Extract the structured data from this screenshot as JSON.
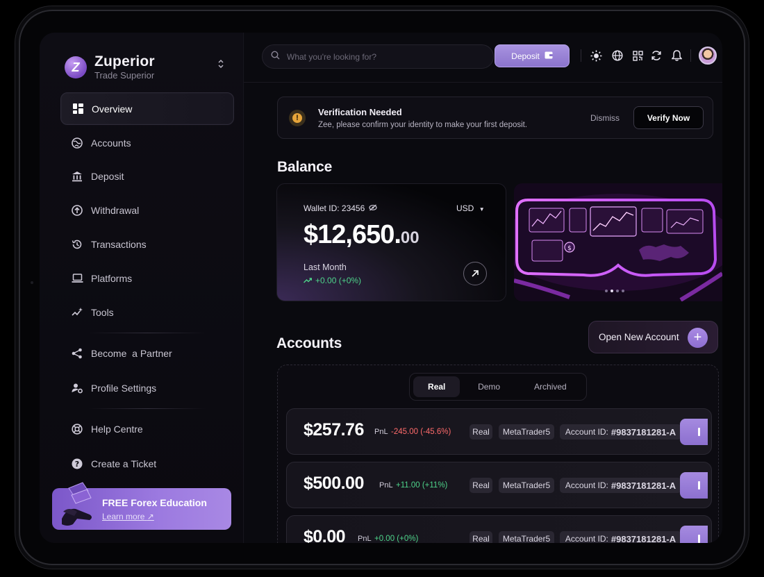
{
  "brand": {
    "name": "Zuperior",
    "tagline": "Trade Superior",
    "logo_letter": "Z"
  },
  "sidebar": {
    "items": [
      {
        "label": "Overview",
        "icon": "grid-icon",
        "active": true
      },
      {
        "label": "Accounts",
        "icon": "globe-accounts-icon"
      },
      {
        "label": "Deposit",
        "icon": "bank-icon"
      },
      {
        "label": "Withdrawal",
        "icon": "arrow-up-circle-icon"
      },
      {
        "label": "Transactions",
        "icon": "history-icon"
      },
      {
        "label": "Platforms",
        "icon": "laptop-icon"
      },
      {
        "label": "Tools",
        "icon": "tools-sparkle-icon"
      },
      {
        "label": "Become  a Partner",
        "icon": "share-icon"
      },
      {
        "label": "Profile Settings",
        "icon": "user-gear-icon"
      },
      {
        "label": "Help Centre",
        "icon": "lifebuoy-icon"
      },
      {
        "label": "Create a Ticket",
        "icon": "question-circle-icon"
      }
    ],
    "promo": {
      "title": "FREE Forex Education",
      "link": "Learn more"
    }
  },
  "topbar": {
    "search_placeholder": "What you're looking for?",
    "deposit_label": "Deposit",
    "icons": [
      "sun-icon",
      "globe-icon",
      "qr-code-icon",
      "refresh-icon",
      "bell-icon"
    ]
  },
  "verification": {
    "title": "Verification Needed",
    "message": "Zee, please confirm your identity to make your first deposit.",
    "dismiss_label": "Dismiss",
    "verify_label": "Verify Now"
  },
  "balance": {
    "section_title": "Balance",
    "wallet_id": "Wallet ID: 23456",
    "currency": "USD",
    "amount_main": "$12,650.",
    "amount_cents": "00",
    "period_label": "Last Month",
    "change": "+0.00 (+0%)"
  },
  "accounts": {
    "section_title": "Accounts",
    "open_new_label": "Open New Account",
    "tabs": [
      "Real",
      "Demo",
      "Archived"
    ],
    "active_tab": "Real",
    "pnl_label": "PnL",
    "account_id_label": "Account ID:",
    "rows": [
      {
        "amount": "$257.76",
        "pnl": "-245.00 (-45.6%)",
        "pnl_dir": "neg",
        "type": "Real",
        "platform": "MetaTrader5",
        "account_id": "#9837181281-A"
      },
      {
        "amount": "$500.00",
        "pnl": "+11.00 (+11%)",
        "pnl_dir": "pos",
        "type": "Real",
        "platform": "MetaTrader5",
        "account_id": "#9837181281-A"
      },
      {
        "amount": "$0.00",
        "pnl": "+0.00 (+0%)",
        "pnl_dir": "pos",
        "type": "Real",
        "platform": "MetaTrader5",
        "account_id": "#9837181281-A"
      }
    ]
  },
  "colors": {
    "accent": "#9b80dc",
    "positive": "#4ed38a",
    "negative": "#ff6b6b",
    "background": "#0a0a0f"
  }
}
